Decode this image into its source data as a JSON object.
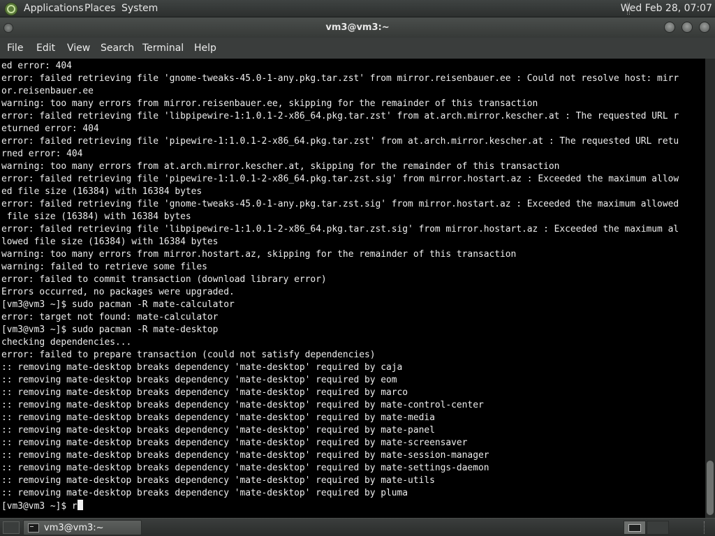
{
  "top_panel": {
    "menus": [
      "Applications",
      "Places",
      "System"
    ],
    "clock": "Wed Feb 28, 07:07"
  },
  "window": {
    "title": "vm3@vm3:~",
    "menubar": [
      "File",
      "Edit",
      "View",
      "Search",
      "Terminal",
      "Help"
    ]
  },
  "terminal": {
    "lines": [
      "ed error: 404",
      "error: failed retrieving file 'gnome-tweaks-45.0-1-any.pkg.tar.zst' from mirror.reisenbauer.ee : Could not resolve host: mirr",
      "or.reisenbauer.ee",
      "warning: too many errors from mirror.reisenbauer.ee, skipping for the remainder of this transaction",
      "error: failed retrieving file 'libpipewire-1:1.0.1-2-x86_64.pkg.tar.zst' from at.arch.mirror.kescher.at : The requested URL r",
      "eturned error: 404",
      "error: failed retrieving file 'pipewire-1:1.0.1-2-x86_64.pkg.tar.zst' from at.arch.mirror.kescher.at : The requested URL retu",
      "rned error: 404",
      "warning: too many errors from at.arch.mirror.kescher.at, skipping for the remainder of this transaction",
      "error: failed retrieving file 'pipewire-1:1.0.1-2-x86_64.pkg.tar.zst.sig' from mirror.hostart.az : Exceeded the maximum allow",
      "ed file size (16384) with 16384 bytes",
      "error: failed retrieving file 'gnome-tweaks-45.0-1-any.pkg.tar.zst.sig' from mirror.hostart.az : Exceeded the maximum allowed",
      " file size (16384) with 16384 bytes",
      "error: failed retrieving file 'libpipewire-1:1.0.1-2-x86_64.pkg.tar.zst.sig' from mirror.hostart.az : Exceeded the maximum al",
      "lowed file size (16384) with 16384 bytes",
      "warning: too many errors from mirror.hostart.az, skipping for the remainder of this transaction",
      "warning: failed to retrieve some files",
      "error: failed to commit transaction (download library error)",
      "Errors occurred, no packages were upgraded.",
      "[vm3@vm3 ~]$ sudo pacman -R mate-calculator",
      "error: target not found: mate-calculator",
      "[vm3@vm3 ~]$ sudo pacman -R mate-desktop",
      "checking dependencies...",
      "error: failed to prepare transaction (could not satisfy dependencies)",
      ":: removing mate-desktop breaks dependency 'mate-desktop' required by caja",
      ":: removing mate-desktop breaks dependency 'mate-desktop' required by eom",
      ":: removing mate-desktop breaks dependency 'mate-desktop' required by marco",
      ":: removing mate-desktop breaks dependency 'mate-desktop' required by mate-control-center",
      ":: removing mate-desktop breaks dependency 'mate-desktop' required by mate-media",
      ":: removing mate-desktop breaks dependency 'mate-desktop' required by mate-panel",
      ":: removing mate-desktop breaks dependency 'mate-desktop' required by mate-screensaver",
      ":: removing mate-desktop breaks dependency 'mate-desktop' required by mate-session-manager",
      ":: removing mate-desktop breaks dependency 'mate-desktop' required by mate-settings-daemon",
      ":: removing mate-desktop breaks dependency 'mate-desktop' required by mate-utils",
      ":: removing mate-desktop breaks dependency 'mate-desktop' required by pluma"
    ],
    "prompt": "[vm3@vm3 ~]$ ",
    "current_input": "r"
  },
  "taskbar": {
    "task_label": "vm3@vm3:~"
  },
  "colors": {
    "terminal_bg": "#000000",
    "terminal_fg": "#eeeeee",
    "panel_bg": "#3a3d3c"
  }
}
